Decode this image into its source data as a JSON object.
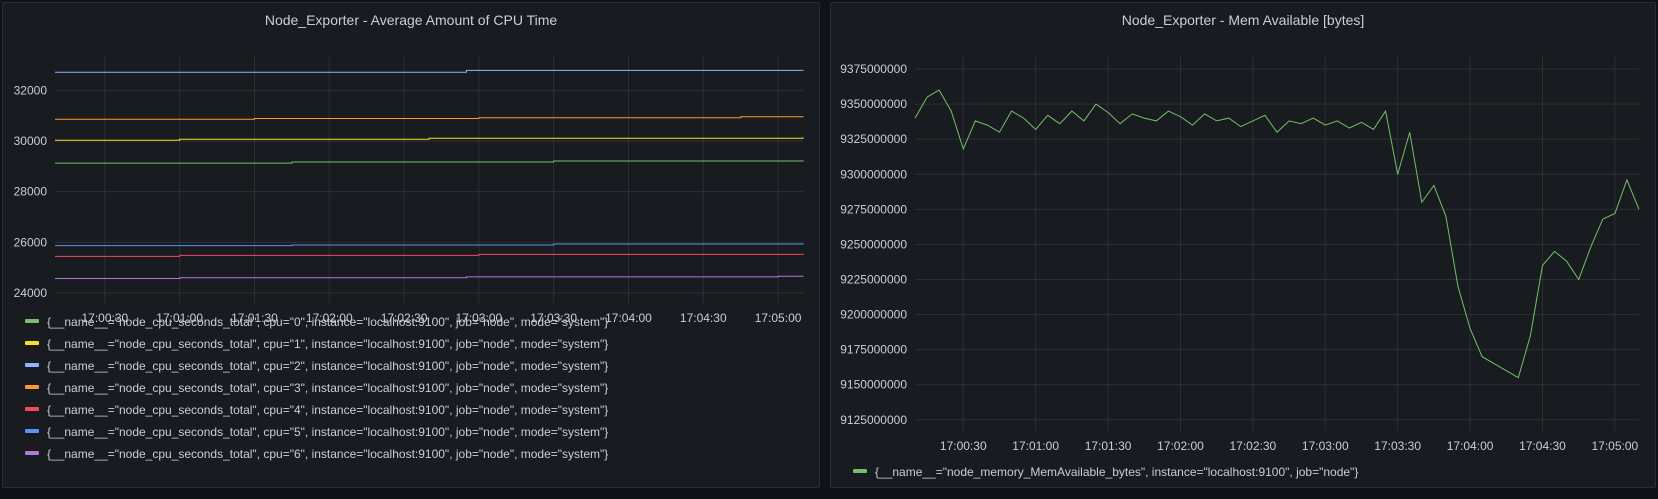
{
  "panels": {
    "cpu": {
      "title": "Node_Exporter - Average Amount of CPU Time"
    },
    "mem": {
      "title": "Node_Exporter - Mem Available [bytes]"
    }
  },
  "chart_data": [
    {
      "type": "line",
      "title": "Node_Exporter - Average Amount of CPU Time",
      "xlabel": "",
      "ylabel": "",
      "x_ticks": [
        "17:00:30",
        "17:01:00",
        "17:01:30",
        "17:02:00",
        "17:02:30",
        "17:03:00",
        "17:03:30",
        "17:04:00",
        "17:04:30",
        "17:05:00"
      ],
      "x_range": [
        "17:00:10",
        "17:05:10"
      ],
      "y_ticks": [
        24000,
        26000,
        28000,
        30000,
        32000
      ],
      "ylim": [
        23600,
        33400
      ],
      "grid": true,
      "legend_position": "bottom",
      "series": [
        {
          "name": "{__name__=\"node_cpu_seconds_total\", cpu=\"0\", instance=\"localhost:9100\", job=\"node\", mode=\"system\"}",
          "color": "#73bf69",
          "x": [
            "17:00:10",
            "17:01:45",
            "17:03:30",
            "17:05:10"
          ],
          "values": [
            29130,
            29170,
            29210,
            29240
          ]
        },
        {
          "name": "{__name__=\"node_cpu_seconds_total\", cpu=\"1\", instance=\"localhost:9100\", job=\"node\", mode=\"system\"}",
          "color": "#fade2a",
          "x": [
            "17:00:10",
            "17:01:00",
            "17:02:40",
            "17:05:10"
          ],
          "values": [
            30030,
            30070,
            30110,
            30150
          ]
        },
        {
          "name": "{__name__=\"node_cpu_seconds_total\", cpu=\"2\", instance=\"localhost:9100\", job=\"node\", mode=\"system\"}",
          "color": "#8ab8ff",
          "x": [
            "17:00:10",
            "17:02:55",
            "17:05:10"
          ],
          "values": [
            32720,
            32790,
            32810
          ]
        },
        {
          "name": "{__name__=\"node_cpu_seconds_total\", cpu=\"3\", instance=\"localhost:9100\", job=\"node\", mode=\"system\"}",
          "color": "#ff9830",
          "x": [
            "17:00:10",
            "17:01:30",
            "17:03:00",
            "17:04:45",
            "17:05:10"
          ],
          "values": [
            30860,
            30890,
            30920,
            30960,
            30980
          ]
        },
        {
          "name": "{__name__=\"node_cpu_seconds_total\", cpu=\"4\", instance=\"localhost:9100\", job=\"node\", mode=\"system\"}",
          "color": "#f2495c",
          "x": [
            "17:00:10",
            "17:01:00",
            "17:03:00",
            "17:05:10"
          ],
          "values": [
            25440,
            25480,
            25520,
            25560
          ]
        },
        {
          "name": "{__name__=\"node_cpu_seconds_total\", cpu=\"5\", instance=\"localhost:9100\", job=\"node\", mode=\"system\"}",
          "color": "#5794f2",
          "x": [
            "17:00:10",
            "17:01:45",
            "17:03:30",
            "17:05:10"
          ],
          "values": [
            25870,
            25890,
            25930,
            25960
          ]
        },
        {
          "name": "{__name__=\"node_cpu_seconds_total\", cpu=\"6\", instance=\"localhost:9100\", job=\"node\", mode=\"system\"}",
          "color": "#b877d9",
          "x": [
            "17:00:10",
            "17:01:00",
            "17:02:55",
            "17:05:00",
            "17:05:10"
          ],
          "values": [
            24570,
            24600,
            24630,
            24660,
            24680
          ]
        }
      ]
    },
    {
      "type": "line",
      "title": "Node_Exporter - Mem Available [bytes]",
      "xlabel": "",
      "ylabel": "",
      "x_ticks": [
        "17:00:30",
        "17:01:00",
        "17:01:30",
        "17:02:00",
        "17:02:30",
        "17:03:00",
        "17:03:30",
        "17:04:00",
        "17:04:30",
        "17:05:00"
      ],
      "x_range": [
        "17:00:10",
        "17:05:10"
      ],
      "y_ticks": [
        9125000000,
        9150000000,
        9175000000,
        9200000000,
        9225000000,
        9250000000,
        9275000000,
        9300000000,
        9325000000,
        9350000000,
        9375000000
      ],
      "ylim": [
        9117000000,
        9385000000
      ],
      "grid": true,
      "legend_position": "bottom",
      "series": [
        {
          "name": "{__name__=\"node_memory_MemAvailable_bytes\", instance=\"localhost:9100\", job=\"node\"}",
          "color": "#73bf69",
          "x": [
            "17:00:10",
            "17:00:15",
            "17:00:20",
            "17:00:25",
            "17:00:30",
            "17:00:35",
            "17:00:40",
            "17:00:45",
            "17:00:50",
            "17:00:55",
            "17:01:00",
            "17:01:05",
            "17:01:10",
            "17:01:15",
            "17:01:20",
            "17:01:25",
            "17:01:30",
            "17:01:35",
            "17:01:40",
            "17:01:45",
            "17:01:50",
            "17:01:55",
            "17:02:00",
            "17:02:05",
            "17:02:10",
            "17:02:15",
            "17:02:20",
            "17:02:25",
            "17:02:30",
            "17:02:35",
            "17:02:40",
            "17:02:45",
            "17:02:50",
            "17:02:55",
            "17:03:00",
            "17:03:05",
            "17:03:10",
            "17:03:15",
            "17:03:20",
            "17:03:25",
            "17:03:30",
            "17:03:35",
            "17:03:40",
            "17:03:45",
            "17:03:50",
            "17:03:55",
            "17:04:00",
            "17:04:05",
            "17:04:10",
            "17:04:15",
            "17:04:20",
            "17:04:25",
            "17:04:30",
            "17:04:35",
            "17:04:40",
            "17:04:45",
            "17:04:50",
            "17:04:55",
            "17:05:00",
            "17:05:05",
            "17:05:10"
          ],
          "values": [
            9340000000,
            9355000000,
            9360000000,
            9345000000,
            9318000000,
            9338000000,
            9335000000,
            9330000000,
            9345000000,
            9340000000,
            9332000000,
            9342000000,
            9336000000,
            9345000000,
            9338000000,
            9350000000,
            9344000000,
            9336000000,
            9343000000,
            9340000000,
            9338000000,
            9345000000,
            9341000000,
            9335000000,
            9343000000,
            9338000000,
            9340000000,
            9334000000,
            9338000000,
            9342000000,
            9330000000,
            9338000000,
            9336000000,
            9340000000,
            9335000000,
            9338000000,
            9333000000,
            9337000000,
            9332000000,
            9345000000,
            9300000000,
            9330000000,
            9280000000,
            9292000000,
            9270000000,
            9220000000,
            9190000000,
            9170000000,
            9165000000,
            9160000000,
            9155000000,
            9185000000,
            9235000000,
            9245000000,
            9238000000,
            9225000000,
            9248000000,
            9268000000,
            9272000000,
            9296000000,
            9275000000
          ]
        }
      ]
    }
  ]
}
